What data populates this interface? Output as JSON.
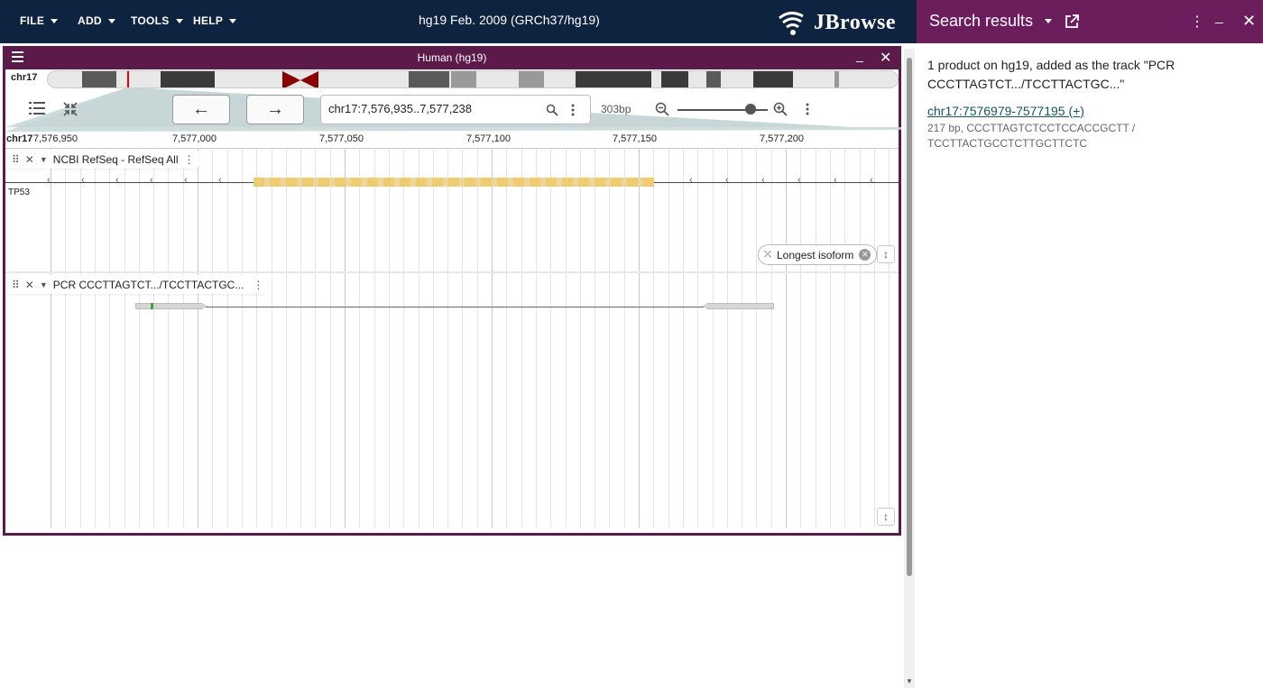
{
  "topbar": {
    "menus": [
      "FILE",
      "ADD",
      "TOOLS",
      "HELP"
    ],
    "assembly_title": "hg19 Feb. 2009 (GRCh37/hg19)",
    "logo_text": "JBrowse"
  },
  "view": {
    "title": "Human (hg19)",
    "chromosome": "chr17",
    "location": "chr17:7,576,935..7,577,238",
    "bp_count": "303bp",
    "ruler_ref": "chr17",
    "ruler_ticks": [
      "7,576,950",
      "7,577,000",
      "7,577,050",
      "7,577,100",
      "7,577,150",
      "7,577,200"
    ],
    "tracks": [
      {
        "name": "NCBI RefSeq - RefSeq All",
        "feature_label": "TP53",
        "chip": "Longest isoform"
      },
      {
        "name": "PCR CCCTTAGTCT.../TCCTTACTGC..."
      }
    ]
  },
  "panel": {
    "title": "Search results",
    "message": "1 product on hg19, added as the track \"PCR CCCTTAGTCT.../TCCTTACTGC...\"",
    "result_link": "chr17:7576979-7577195 (+)",
    "result_info": "217 bp, CCCTTAGTCTCCTCCACCGCTT / TCCTTACTGCCTCTTGCTTCTC"
  },
  "colors": {
    "topbar": "#0d233f",
    "view_header": "#5c1a4a",
    "panel_header": "#6b1d5c",
    "gene_feature": "#f0cc6c",
    "pcr_feature": "#d6d6d6"
  }
}
